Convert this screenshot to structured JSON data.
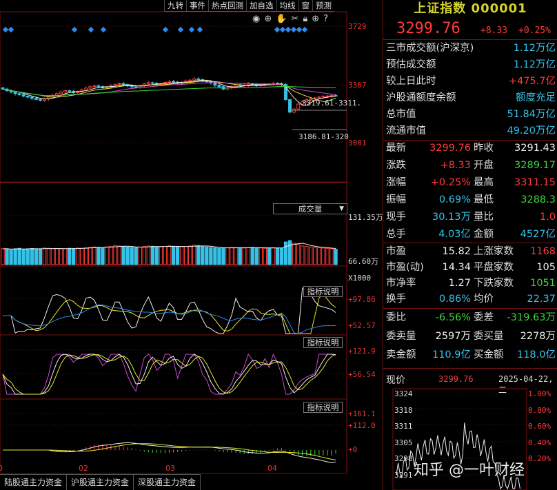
{
  "toolbar": {
    "items": [
      "九转",
      "事件",
      "热点回测",
      "加自选",
      "均线",
      "窗",
      "预测"
    ]
  },
  "chart_data": [
    {
      "type": "candlestick",
      "name": "price",
      "y_labels": [
        "3729",
        "3367",
        "3001"
      ],
      "annotations": [
        "3319.61-3311.",
        "3186.81-320"
      ],
      "period_labels": [
        "02",
        "03",
        "04"
      ],
      "closes": [
        3340,
        3330,
        3322,
        3312,
        3305,
        3296,
        3290,
        3282,
        3275,
        3270,
        3278,
        3290,
        3302,
        3312,
        3322,
        3330,
        3326,
        3318,
        3325,
        3335,
        3346,
        3355,
        3360,
        3356,
        3348,
        3352,
        3362,
        3370,
        3374,
        3368,
        3360,
        3354,
        3350,
        3362,
        3372,
        3380,
        3376,
        3368,
        3371,
        3382,
        3388,
        3384,
        3376,
        3382,
        3390,
        3396,
        3404,
        3399,
        3390,
        3386,
        3378,
        3364,
        3355,
        3340,
        3348,
        3356,
        3368,
        3362,
        3366,
        3374,
        3369,
        3362,
        3366,
        3372,
        3370,
        3376,
        3373,
        3369,
        3274,
        3196,
        3215,
        3246,
        3262,
        3274,
        3280,
        3285,
        3290,
        3294,
        3297,
        3300,
        3299
      ]
    },
    {
      "type": "bar",
      "name": "volume",
      "y_labels": [
        "131.35万",
        "66.60万"
      ],
      "unit_label": "X1000",
      "values": [
        7,
        7,
        6.5,
        7,
        7.2,
        6.8,
        7,
        7.1,
        6.9,
        7,
        7.3,
        7.2,
        7,
        7.1,
        6.9,
        7,
        7.2,
        7.1,
        7.3,
        7.2,
        7.4,
        7.6,
        7.8,
        7.6,
        7.4,
        7.8,
        8,
        8.4,
        8.2,
        8,
        7.8,
        7.6,
        7.5,
        7.7,
        8,
        8.2,
        8.1,
        7.9,
        7.8,
        8,
        8.3,
        8.1,
        7.9,
        7.8,
        7.9,
        8.2,
        8.6,
        8.4,
        8,
        7.8,
        7.6,
        7.4,
        7.2,
        7.3,
        7.4,
        7.6,
        7.5,
        7.4,
        7.3,
        7.5,
        7.6,
        7.4,
        7.3,
        7.2,
        7.4,
        7.5,
        7.3,
        7.2,
        10,
        10.6,
        9.4,
        8.8,
        8.2,
        8,
        7.8,
        7.6,
        7.4,
        7.3,
        7.1,
        7,
        6.8
      ]
    },
    {
      "type": "line",
      "name": "indicator-1",
      "y_labels": [
        "+97.86",
        "+52.57"
      ]
    },
    {
      "type": "line",
      "name": "indicator-2",
      "y_labels": [
        "+121.9",
        "+56.54"
      ]
    },
    {
      "type": "line",
      "name": "macd",
      "y_labels": [
        "+161.1",
        "+112.0",
        "+0"
      ]
    }
  ],
  "panels": {
    "volume_selector": "成交量",
    "indicator_btn": "指标说明"
  },
  "bottom_tabs": [
    "陆股通主力资金",
    "沪股通主力资金",
    "深股通主力资金"
  ],
  "quote": {
    "title": "上证指数 000001",
    "price": "3299.76",
    "change": "+8.33",
    "change_pct": "+0.25%",
    "stats": [
      {
        "label": "三市成交额(沪深京)",
        "value": "1.12万亿",
        "cls": "cyan"
      },
      {
        "label": "预估成交额",
        "value": "1.12万亿",
        "cls": "cyan"
      },
      {
        "label": "较上日此时",
        "value": "+475.7亿",
        "cls": "red"
      },
      {
        "label": "沪股通额度余额",
        "value": "额度充足",
        "cls": "cyan"
      },
      {
        "label": "总市值",
        "value": "51.84万亿",
        "cls": "cyan"
      },
      {
        "label": "流通市值",
        "value": "49.20万亿",
        "cls": "cyan"
      }
    ],
    "grid": [
      {
        "l1": "最新",
        "v1": "3299.76",
        "c1": "red",
        "l2": "昨收",
        "v2": "3291.43",
        "c2": "wht"
      },
      {
        "l1": "涨跌",
        "v1": "+8.33",
        "c1": "red",
        "l2": "开盘",
        "v2": "3289.17",
        "c2": "grn"
      },
      {
        "l1": "涨幅",
        "v1": "+0.25%",
        "c1": "red",
        "l2": "最高",
        "v2": "3311.15",
        "c2": "red"
      },
      {
        "l1": "振幅",
        "v1": "0.69%",
        "c1": "cyan",
        "l2": "最低",
        "v2": "3288.3",
        "c2": "grn"
      },
      {
        "l1": "现手",
        "v1": "30.13万",
        "c1": "cyan",
        "l2": "量比",
        "v2": "1.0",
        "c2": "red"
      },
      {
        "l1": "总手",
        "v1": "4.03亿",
        "c1": "cyan",
        "l2": "金额",
        "v2": "4527亿",
        "c2": "cyan"
      }
    ],
    "grid2": [
      {
        "l1": "市盈",
        "v1": "15.82",
        "c1": "wht",
        "l2": "上涨家数",
        "v2": "1168",
        "c2": "red"
      },
      {
        "l1": "市盈(动)",
        "v1": "14.34",
        "c1": "wht",
        "l2": "平盘家数",
        "v2": "105",
        "c2": "wht"
      },
      {
        "l1": "市净率",
        "v1": "1.27",
        "c1": "wht",
        "l2": "下跌家数",
        "v2": "1051",
        "c2": "grn"
      },
      {
        "l1": "换手",
        "v1": "0.86%",
        "c1": "cyan",
        "l2": "均价",
        "v2": "22.37",
        "c2": "cyan"
      }
    ],
    "grid3": [
      {
        "l1": "委比",
        "v1": "-6.56%",
        "c1": "grn",
        "l2": "委差",
        "v2": "-319.63万",
        "c2": "grn"
      },
      {
        "l1": "委卖量",
        "v1": "2597万",
        "c1": "wht",
        "l2": "委买量",
        "v2": "2278万",
        "c2": "wht"
      },
      {
        "l1": "卖金额",
        "v1": "110.9亿",
        "c1": "cyan",
        "l2": "买金额",
        "v2": "118.0亿",
        "c2": "cyan"
      }
    ],
    "intraday": {
      "label": "现价",
      "price": "3299.76",
      "date": "2025-04-22,二",
      "y_left": [
        "3324",
        "3318",
        "3311",
        "3305",
        "3298",
        "3291"
      ],
      "y_right": [
        "1.00%",
        "0.80%",
        "0.60%",
        "0.40%",
        "0.20%"
      ]
    }
  },
  "watermark": "知乎 @一叶财经",
  "colors": {
    "up": "#ff3b3b",
    "down": "#36c2e8",
    "frame": "#7a1010"
  }
}
